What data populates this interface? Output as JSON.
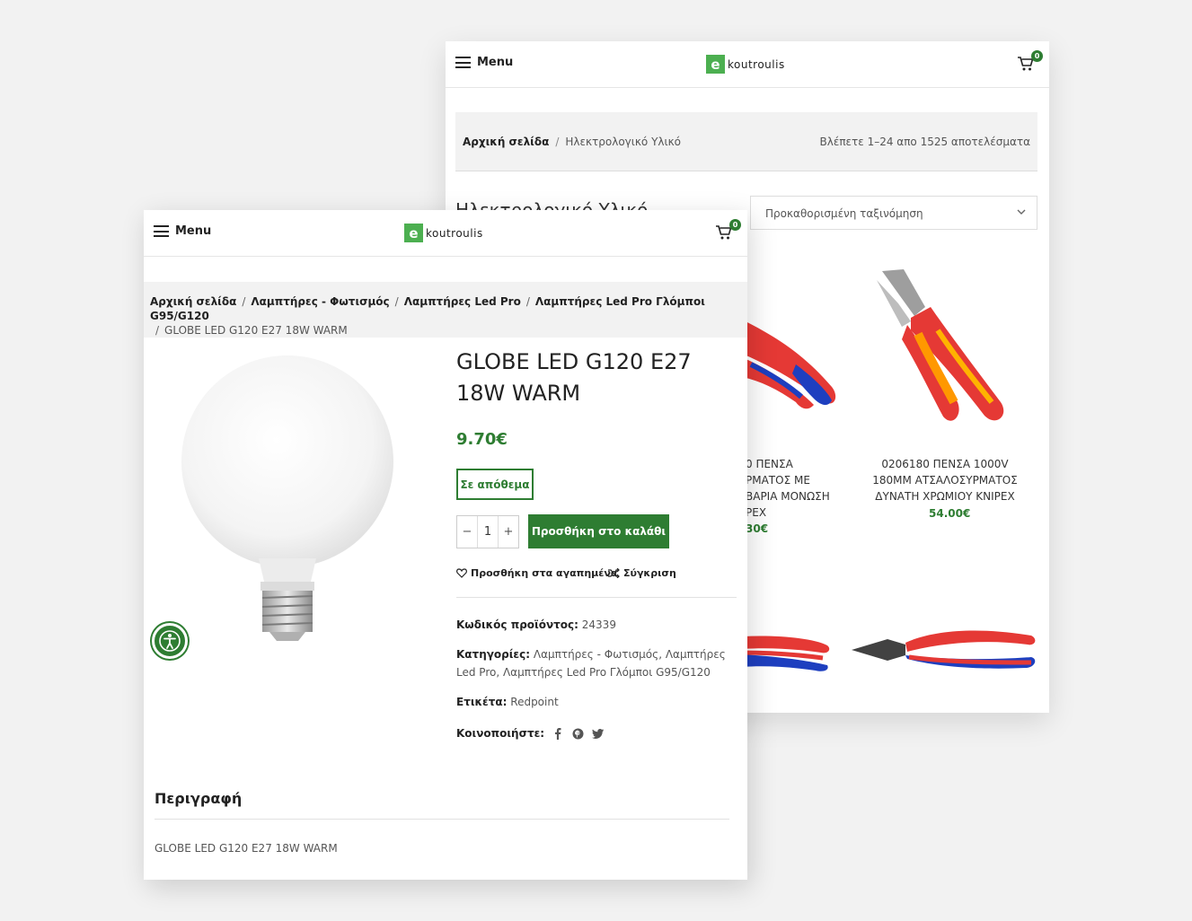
{
  "colors": {
    "brand_green": "#2e7d32",
    "logo_green": "#4caf50",
    "background": "#f2f2f2"
  },
  "back_window": {
    "header": {
      "menu_label": "Menu",
      "logo_letter": "e",
      "logo_text": "koutroulis",
      "cart_count": "0"
    },
    "breadcrumb": {
      "home": "Αρχική σελίδα",
      "separator": "/",
      "current": "Ηλεκτρολογικό Υλικό"
    },
    "results_count": "Βλέπετε 1–24 απο 1525 αποτελέσματα",
    "heading_partial": "Ηλεκτρολογικό Υλικό",
    "sort": {
      "selected": "Προκαθορισμένη ταξινόμηση",
      "icon": "chevron-down-icon"
    },
    "products": [
      {
        "name": "0 ΠΕΝΣΑ\nΡΜΑΤΟΣ ΜΕ\nΒΑΡΙΑ ΜΟΝΩΣΗ\nPEX",
        "price": "30€"
      },
      {
        "name": "0206180 ΠΕΝΣΑ 1000V 180MM ΑΤΣΑΛΟΣΥΡΜΑΤΟΣ ΔΥΝΑΤΗ ΧΡΩΜΙΟΥ KNIPEX",
        "price": "54.00€"
      }
    ]
  },
  "front_window": {
    "header": {
      "menu_label": "Menu",
      "logo_letter": "e",
      "logo_text": "koutroulis",
      "cart_count": "0"
    },
    "breadcrumb": {
      "items": [
        "Αρχική σελίδα",
        "Λαμπτήρες - Φωτισμός",
        "Λαμπτήρες Led Pro",
        "Λαμπτήρες Led Pro Γλόμποι G95/G120"
      ],
      "separator": "/",
      "current": "GLOBE LED G120 E27 18W WARM"
    },
    "product": {
      "title": "GLOBE LED G120 E27 18W WARM",
      "price": "9.70€",
      "stock": "Σε απόθεμα",
      "qty_minus": "−",
      "qty_value": "1",
      "qty_plus": "+",
      "add_to_cart": "Προσθήκη στο καλάθι",
      "wishlist": "Προσθήκη στα αγαπημένα",
      "compare": "Σύγκριση",
      "sku_label": "Κωδικός προϊόντος:",
      "sku": "24339",
      "categories_label": "Κατηγορίες:",
      "categories": [
        "Λαμπτήρες - Φωτισμός",
        "Λαμπτήρες Led Pro",
        "Λαμπτήρες Led Pro Γλόμποι G95/G120"
      ],
      "tag_label": "Ετικέτα:",
      "tag": "Redpoint",
      "share_label": "Κοινοποιήστε:",
      "share_icons": [
        "facebook-icon",
        "pinterest-icon",
        "twitter-icon"
      ]
    },
    "description": {
      "heading": "Περιγραφή",
      "text": "GLOBE LED G120 E27 18W WARM"
    }
  }
}
